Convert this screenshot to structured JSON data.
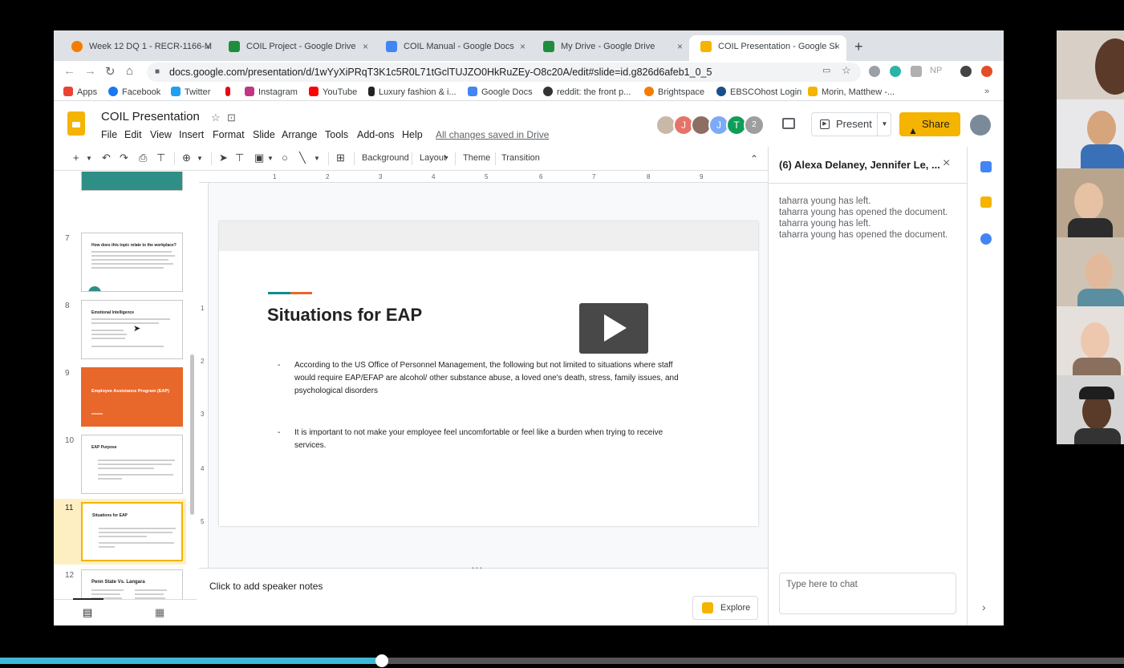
{
  "browser": {
    "tabs": [
      {
        "label": "Week 12 DQ 1 - RECR-1166-M",
        "color": "#f57c00"
      },
      {
        "label": "COIL Project - Google Drive",
        "color": "#1e8e3e"
      },
      {
        "label": "COIL Manual - Google Docs",
        "color": "#4285f4"
      },
      {
        "label": "My Drive - Google Drive",
        "color": "#1e8e3e"
      },
      {
        "label": "COIL Presentation - Google Sl",
        "color": "#f4b400"
      }
    ],
    "new_tab": "+",
    "close_glyph": "×",
    "url": "docs.google.com/presentation/d/1wYyXiPRqT3K1c5R0L71tGclTUJZO0HkRuZEy-O8c20A/edit#slide=id.g826d6afeb1_0_5",
    "ext_label": "NP",
    "bookmarks": [
      {
        "label": "Apps",
        "color": "#ea4335"
      },
      {
        "label": "Facebook",
        "color": "#1877f2"
      },
      {
        "label": "Twitter",
        "color": "#1da1f2"
      },
      {
        "label": "",
        "color": "#e50914"
      },
      {
        "label": "Instagram",
        "color": "#c13584"
      },
      {
        "label": "YouTube",
        "color": "#ff0000"
      },
      {
        "label": "Luxury fashion & i...",
        "color": "#222222"
      },
      {
        "label": "Google Docs",
        "color": "#4285f4"
      },
      {
        "label": "reddit: the front p...",
        "color": "#333333"
      },
      {
        "label": "Brightspace",
        "color": "#f57c00"
      },
      {
        "label": "EBSCOhost Login",
        "color": "#1a4f8b"
      },
      {
        "label": "Morin, Matthew -...",
        "color": "#f4b400"
      }
    ],
    "bookmarks_more": "»"
  },
  "doc": {
    "title": "COIL Presentation",
    "menus": [
      "File",
      "Edit",
      "View",
      "Insert",
      "Format",
      "Slide",
      "Arrange",
      "Tools",
      "Add-ons",
      "Help"
    ],
    "saved_status": "All changes saved in Drive",
    "avatars": [
      {
        "letter": "",
        "color": "#c9b8a8"
      },
      {
        "letter": "J",
        "color": "#e57368"
      },
      {
        "letter": "",
        "color": "#8d6e63"
      },
      {
        "letter": "J",
        "color": "#7baaf7"
      },
      {
        "letter": "T",
        "color": "#0f9d58"
      },
      {
        "letter": "2",
        "color": "#9e9e9e"
      }
    ],
    "present_label": "Present",
    "share_label": "Share"
  },
  "toolbar": {
    "background": "Background",
    "layout": "Layout",
    "theme": "Theme",
    "transition": "Transition"
  },
  "filmstrip": {
    "slides": [
      {
        "num": "7",
        "title": "How does this topic relate to the workplace?",
        "style": "plain"
      },
      {
        "num": "8",
        "title": "Emotional Intelligence",
        "style": "plain"
      },
      {
        "num": "9",
        "title": "Employee Assistance Program (EAP)",
        "style": "orange"
      },
      {
        "num": "10",
        "title": "EAP Purpose",
        "style": "plain"
      },
      {
        "num": "11",
        "title": "Situations for EAP",
        "style": "selected"
      },
      {
        "num": "12",
        "title": "Penn State Vs. Langara",
        "style": "plain"
      }
    ]
  },
  "slide": {
    "title": "Situations for EAP",
    "bullets": [
      "According to the US Office of Personnel Management, the following but not limited to situations where staff would require EAP/EFAP are alcohol/ other substance abuse, a loved one's death, stress, family issues, and psychological disorders",
      "It is important to not make your employee feel uncomfortable or feel like a burden when trying to receive services."
    ],
    "bullet_glyph": "-",
    "accent_colors": [
      "#0e8d8d",
      "#e8672b"
    ]
  },
  "notes": {
    "placeholder": "Click to add speaker notes",
    "explore_label": "Explore"
  },
  "chat": {
    "title": "(6) Alexa Delaney, Jennifer Le, ...",
    "messages": [
      "taharra young has left.",
      "taharra young has opened the document.",
      "taharra young has left.",
      "taharra young has opened the document."
    ],
    "input_placeholder": "Type here to chat"
  },
  "video": {
    "progress": 0.34,
    "accent": "#3eb8d8"
  }
}
